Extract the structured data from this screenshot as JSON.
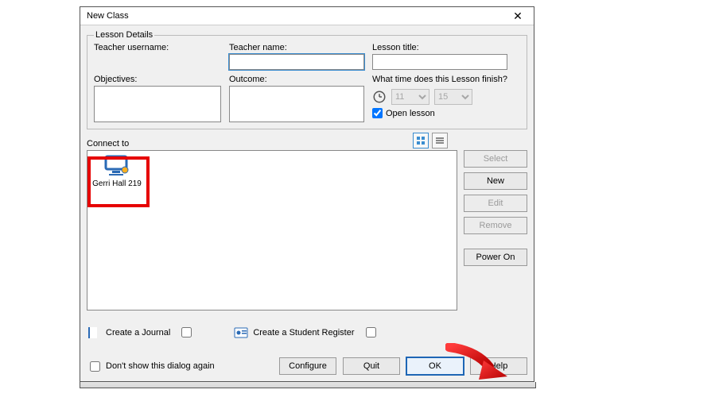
{
  "window": {
    "title": "New Class"
  },
  "groupbox_title": "Lesson Details",
  "labels": {
    "teacher_username": "Teacher username:",
    "teacher_name": "Teacher name:",
    "lesson_title": "Lesson title:",
    "objectives": "Objectives:",
    "outcome": "Outcome:",
    "finish_time": "What time does this Lesson finish?",
    "open_lesson": "Open lesson",
    "connect_to": "Connect to",
    "create_journal": "Create a Journal",
    "create_register": "Create a Student Register",
    "dont_show": "Don't show this dialog again"
  },
  "fields": {
    "teacher_username": "",
    "teacher_name": "",
    "lesson_title": "",
    "objectives": "",
    "outcome": ""
  },
  "time": {
    "hour_options": [
      "11"
    ],
    "minute_options": [
      "15"
    ],
    "hour_selected": "11",
    "minute_selected": "15",
    "open_lesson_checked": true
  },
  "clients": [
    {
      "label": "Gerri Hall 219"
    }
  ],
  "side_buttons": {
    "select": "Select",
    "new": "New",
    "edit": "Edit",
    "remove": "Remove",
    "poweron": "Power On"
  },
  "footer_buttons": {
    "configure": "Configure",
    "quit": "Quit",
    "ok": "OK",
    "help": "Help"
  },
  "options": {
    "journal_checked": false,
    "register_checked": false,
    "dont_show_checked": false
  }
}
